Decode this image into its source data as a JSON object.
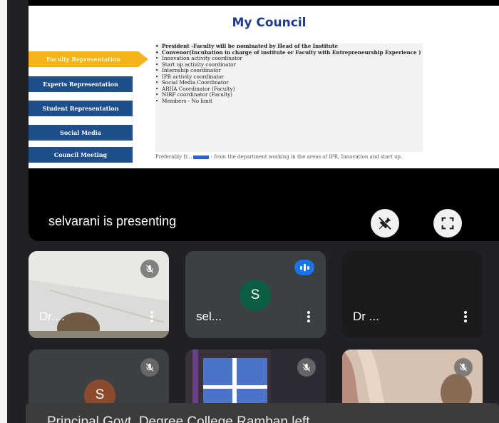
{
  "slide": {
    "title": "My Council",
    "buttons": [
      {
        "label": "Faculty Representation",
        "active": true
      },
      {
        "label": "Experts Representation",
        "active": false
      },
      {
        "label": "Student Representation",
        "active": false
      },
      {
        "label": "Social Media",
        "active": false
      },
      {
        "label": "Council Meeting",
        "active": false
      }
    ],
    "list": [
      {
        "text": "President -Faculty will be nominated by Head of the Institute",
        "bold": true
      },
      {
        "text": "Convenor(Incubation in charge of institute or Faculty with Entrepreneurship Experience )",
        "bold": true
      },
      {
        "text": "Innovation activity coordinator",
        "bold": false
      },
      {
        "text": "Start up activity coordinator",
        "bold": false
      },
      {
        "text": "Internship coordinator",
        "bold": false
      },
      {
        "text": "IPR activity coordinator",
        "bold": false
      },
      {
        "text": "Social Media Coordinator",
        "bold": false
      },
      {
        "text": "ARIIA Coordinator (Faculty)",
        "bold": false
      },
      {
        "text": "NIRF coordinator (Faculty)",
        "bold": false
      },
      {
        "text": "Members - No limit",
        "bold": false
      }
    ],
    "footnote_a": "Preferably fr...",
    "footnote_b": "- from the department working in the areas of IPR, Innovation and start up."
  },
  "stage": {
    "presenting_text": "selvarani is presenting"
  },
  "tiles": [
    {
      "name": "Dr....",
      "avatar": "",
      "muted": true
    },
    {
      "name": "sel...",
      "avatar": "S",
      "muted": false,
      "speaking": true
    },
    {
      "name": "Dr ...",
      "avatar": "",
      "muted": false
    },
    {
      "name": "",
      "avatar": "S",
      "muted": true
    },
    {
      "name": "",
      "avatar": "",
      "muted": true
    },
    {
      "name": "",
      "avatar": "",
      "muted": true
    }
  ],
  "toast": {
    "text": "Principal Govt. Degree College Ramban left"
  },
  "colors": {
    "background": "#202124",
    "tile": "#3c4043",
    "avatar_green": "#0b5e43",
    "avatar_brown": "#8d4b2e",
    "speaking_blue": "#1a73e8",
    "slide_title": "#1f3b8a",
    "active_button": "#f2b31b",
    "button": "#1f4e8c"
  }
}
